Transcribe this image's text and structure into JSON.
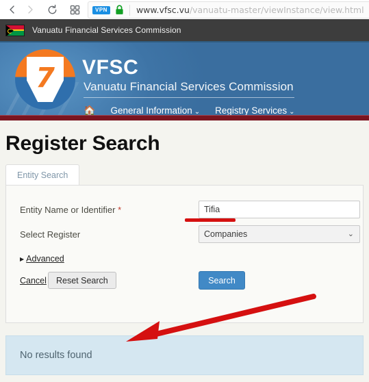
{
  "browser": {
    "back_icon": "chevron-left-icon",
    "forward_icon": "chevron-right-icon",
    "reload_icon": "reload-icon",
    "apps_icon": "grid-apps-icon",
    "vpn_badge": "VPN",
    "lock_icon": "padlock-secure-icon",
    "url_domain": "www.vfsc.vu",
    "url_path": "/vanuatu-master/viewInstance/view.html"
  },
  "site_strip": {
    "flag_icon": "vanuatu-flag-icon",
    "title": "Vanuatu Financial Services Commission"
  },
  "banner": {
    "logo_icon": "vfsc-logo-icon",
    "logo_mark": "7",
    "brand": "VFSC",
    "brand_sub": "Vanuatu Financial Services Commission",
    "nav": {
      "home_icon": "home-icon",
      "items": [
        {
          "label": "General Information",
          "caret": "⌄"
        },
        {
          "label": "Registry Services",
          "caret": "⌄"
        }
      ]
    }
  },
  "page": {
    "title": "Register Search",
    "tabs": [
      {
        "label": "Entity Search",
        "active": true
      }
    ],
    "form": {
      "entity_label": "Entity Name or Identifier",
      "entity_required_mark": "*",
      "entity_value": "Tifia",
      "register_label": "Select Register",
      "register_value": "Companies",
      "register_caret": "⌄",
      "advanced_label": "Advanced",
      "advanced_triangle": "▶",
      "cancel_label": "Cancel",
      "reset_label": "Reset Search",
      "search_label": "Search"
    },
    "results": {
      "message": "No results found"
    }
  },
  "annotations": {
    "underline_color": "#d51010",
    "arrow_color": "#d51010",
    "underline_target": "entity-name-input",
    "arrow_target": "results-message"
  },
  "colors": {
    "banner_blue": "#4189c6",
    "banner_rule_red": "#7a1520",
    "logo_orange": "#f47920",
    "button_blue": "#4189c6",
    "results_bg": "#d5e7f1",
    "page_bg": "#f4f4ef"
  }
}
